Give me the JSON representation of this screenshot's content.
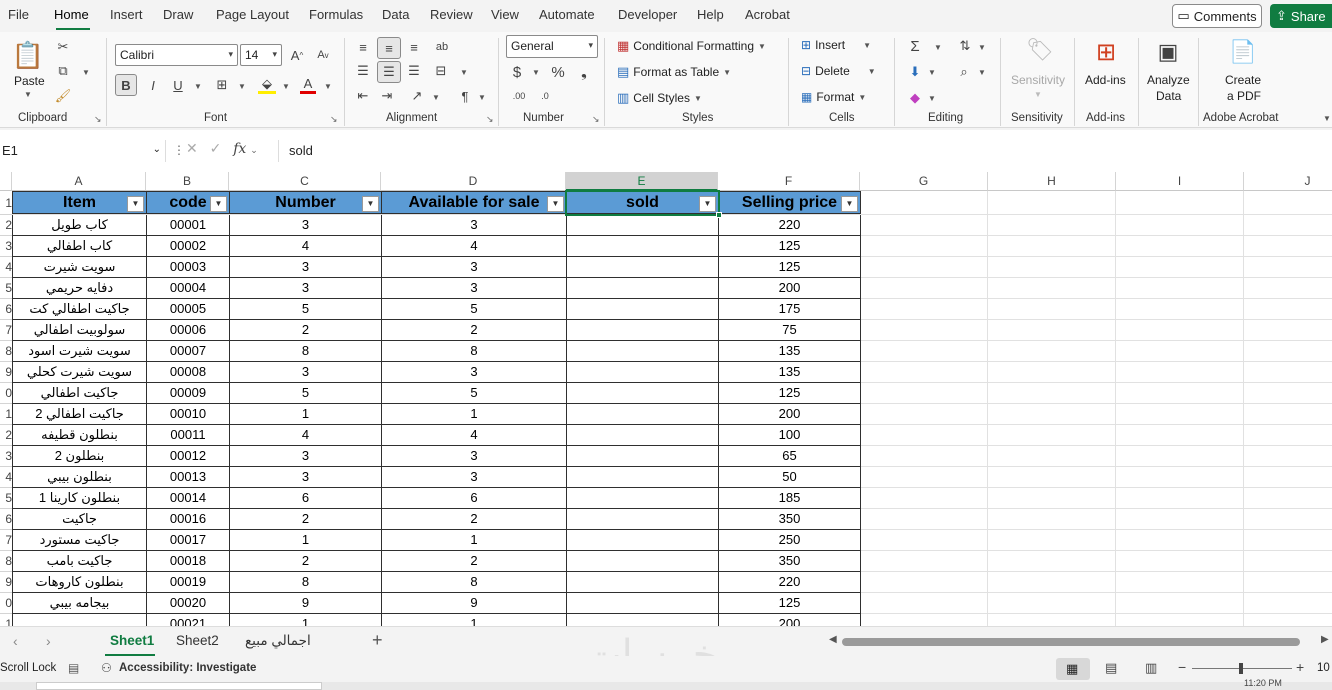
{
  "menu": {
    "tabs": [
      "File",
      "Home",
      "Insert",
      "Draw",
      "Page Layout",
      "Formulas",
      "Data",
      "Review",
      "View",
      "Automate",
      "Developer",
      "Help",
      "Acrobat"
    ],
    "active": "Home",
    "comments_label": "Comments",
    "share_label": "Share"
  },
  "ribbon": {
    "clipboard": {
      "paste": "Paste",
      "label": "Clipboard"
    },
    "font": {
      "name": "Calibri",
      "size": "14",
      "label": "Font"
    },
    "alignment": {
      "label": "Alignment"
    },
    "number": {
      "format": "General",
      "label": "Number"
    },
    "styles": {
      "conditional": "Conditional Formatting",
      "format_table": "Format as Table",
      "cell_styles": "Cell Styles",
      "label": "Styles"
    },
    "cells": {
      "insert": "Insert",
      "delete": "Delete",
      "format": "Format",
      "label": "Cells"
    },
    "editing": {
      "label": "Editing"
    },
    "sensitivity": {
      "button": "Sensitivity",
      "label": "Sensitivity"
    },
    "addins": {
      "button": "Add-ins",
      "label": "Add-ins"
    },
    "analyze": {
      "button_line1": "Analyze",
      "button_line2": "Data"
    },
    "acrobat": {
      "button_line1": "Create",
      "button_line2": "a PDF",
      "label": "Adobe Acrobat"
    }
  },
  "formula_bar": {
    "name_box": "E1",
    "fx": "fx",
    "content": "sold"
  },
  "columns": [
    "A",
    "B",
    "C",
    "D",
    "E",
    "F",
    "G",
    "H",
    "I",
    "J"
  ],
  "selected_column": "E",
  "table": {
    "headers": [
      "Item",
      "code",
      "Number",
      "Available for sale",
      "sold",
      "Selling price"
    ],
    "rows": [
      [
        "كاب طويل",
        "00001",
        "3",
        "3",
        "",
        "220"
      ],
      [
        "كاب اطفالي",
        "00002",
        "4",
        "4",
        "",
        "125"
      ],
      [
        "سويت شيرت",
        "00003",
        "3",
        "3",
        "",
        "125"
      ],
      [
        "دفايه حريمي",
        "00004",
        "3",
        "3",
        "",
        "200"
      ],
      [
        "جاكيت اطفالي كت",
        "00005",
        "5",
        "5",
        "",
        "175"
      ],
      [
        "سولوبيت اطفالي",
        "00006",
        "2",
        "2",
        "",
        "75"
      ],
      [
        "سويت شيرت اسود",
        "00007",
        "8",
        "8",
        "",
        "135"
      ],
      [
        "سويت شيرت كحلي",
        "00008",
        "3",
        "3",
        "",
        "135"
      ],
      [
        "جاكيت اطفالي",
        "00009",
        "5",
        "5",
        "",
        "125"
      ],
      [
        "جاكيت اطفالي 2",
        "00010",
        "1",
        "1",
        "",
        "200"
      ],
      [
        "بنطلون قطيفه",
        "00011",
        "4",
        "4",
        "",
        "100"
      ],
      [
        "بنطلون 2",
        "00012",
        "3",
        "3",
        "",
        "65"
      ],
      [
        "بنطلون بيبي",
        "00013",
        "3",
        "3",
        "",
        "50"
      ],
      [
        "بنطلون كارينا 1",
        "00014",
        "6",
        "6",
        "",
        "185"
      ],
      [
        "جاكيت",
        "00016",
        "2",
        "2",
        "",
        "350"
      ],
      [
        "جاكيت مستورد",
        "00017",
        "1",
        "1",
        "",
        "250"
      ],
      [
        "جاكيت بامب",
        "00018",
        "2",
        "2",
        "",
        "350"
      ],
      [
        "بنطلون كاروهات",
        "00019",
        "8",
        "8",
        "",
        "220"
      ],
      [
        "بيجامه بيبي",
        "00020",
        "9",
        "9",
        "",
        "125"
      ],
      [
        "",
        "00021",
        "1",
        "1",
        "",
        "200"
      ]
    ]
  },
  "row_numbers": [
    "1",
    "2",
    "3",
    "4",
    "5",
    "6",
    "7",
    "8",
    "9",
    "0",
    "1",
    "2",
    "3",
    "4",
    "5",
    "6",
    "7",
    "8",
    "9",
    "0",
    "1"
  ],
  "sheets": [
    "Sheet1",
    "Sheet2",
    "اجمالي مبيع"
  ],
  "active_sheet": "Sheet1",
  "status": {
    "scroll_lock": "Scroll Lock",
    "accessibility": "Accessibility: Investigate",
    "zoom": "10",
    "clock": "11:20 PM"
  },
  "watermark": "خمسات",
  "colors": {
    "excel_green": "#107c41",
    "header_fill": "#5b9bd5"
  }
}
